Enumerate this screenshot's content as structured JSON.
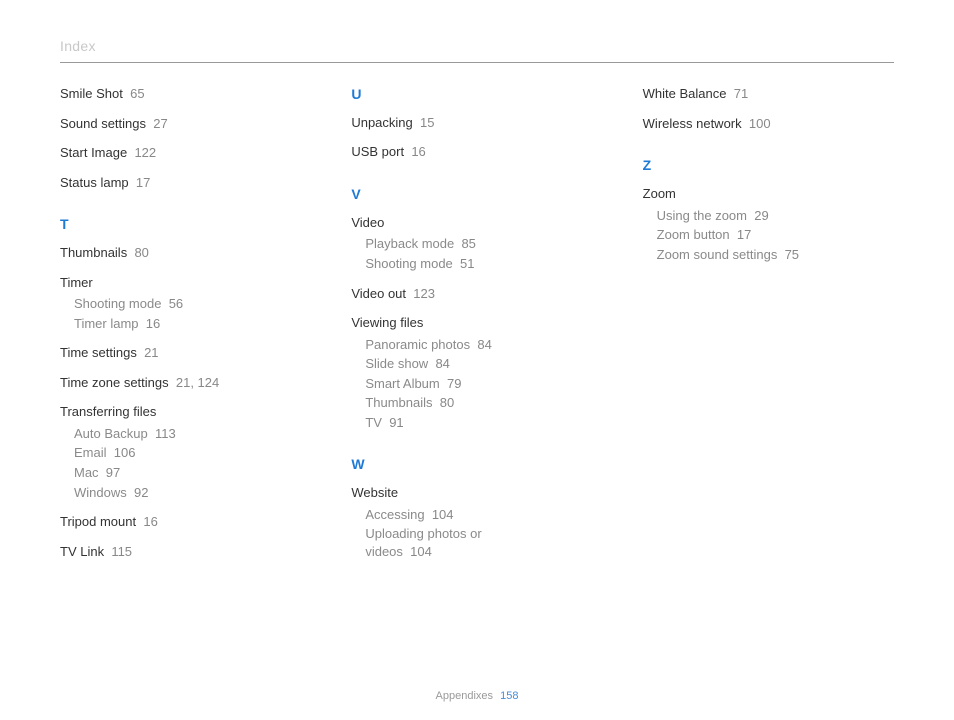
{
  "header": {
    "title": "Index"
  },
  "footer": {
    "section": "Appendixes",
    "page": "158"
  },
  "col1": {
    "loose": [
      {
        "label": "Smile Shot",
        "pages": "65"
      },
      {
        "label": "Sound settings",
        "pages": "27"
      },
      {
        "label": "Start Image",
        "pages": "122"
      },
      {
        "label": "Status lamp",
        "pages": "17"
      }
    ],
    "letterT": "T",
    "t_thumbnails": {
      "label": "Thumbnails",
      "pages": "80"
    },
    "t_timer": {
      "label": "Timer",
      "subs": [
        {
          "label": "Shooting mode",
          "pages": "56"
        },
        {
          "label": "Timer lamp",
          "pages": "16"
        }
      ]
    },
    "t_time_settings": {
      "label": "Time settings",
      "pages": "21"
    },
    "t_timezone": {
      "label": "Time zone settings",
      "pages": "21, 124"
    },
    "t_transfer": {
      "label": "Transferring files",
      "subs": [
        {
          "label": "Auto Backup",
          "pages": "113"
        },
        {
          "label": "Email",
          "pages": "106"
        },
        {
          "label": "Mac",
          "pages": "97"
        },
        {
          "label": "Windows",
          "pages": "92"
        }
      ]
    },
    "t_tripod": {
      "label": "Tripod mount",
      "pages": "16"
    },
    "t_tvlink": {
      "label": "TV Link",
      "pages": "115"
    }
  },
  "col2": {
    "letterU": "U",
    "u_unpacking": {
      "label": "Unpacking",
      "pages": "15"
    },
    "u_usb": {
      "label": "USB port",
      "pages": "16"
    },
    "letterV": "V",
    "v_video": {
      "label": "Video",
      "subs": [
        {
          "label": "Playback mode",
          "pages": "85"
        },
        {
          "label": "Shooting mode",
          "pages": "51"
        }
      ]
    },
    "v_videoout": {
      "label": "Video out",
      "pages": "123"
    },
    "v_view": {
      "label": "Viewing files",
      "subs": [
        {
          "label": "Panoramic photos",
          "pages": "84"
        },
        {
          "label": "Slide show",
          "pages": "84"
        },
        {
          "label": "Smart Album",
          "pages": "79"
        },
        {
          "label": "Thumbnails",
          "pages": "80"
        },
        {
          "label": "TV",
          "pages": "91"
        }
      ]
    },
    "letterW": "W",
    "w_site": {
      "label": "Website",
      "subs": [
        {
          "label": "Accessing",
          "pages": "104"
        },
        {
          "label": "Uploading photos or videos",
          "pages": "104"
        }
      ]
    }
  },
  "col3": {
    "loose": [
      {
        "label": "White Balance",
        "pages": "71"
      },
      {
        "label": "Wireless network",
        "pages": "100"
      }
    ],
    "letterZ": "Z",
    "z_zoom": {
      "label": "Zoom",
      "subs": [
        {
          "label": "Using the zoom",
          "pages": "29"
        },
        {
          "label": "Zoom button",
          "pages": "17"
        },
        {
          "label": "Zoom sound settings",
          "pages": "75"
        }
      ]
    }
  }
}
